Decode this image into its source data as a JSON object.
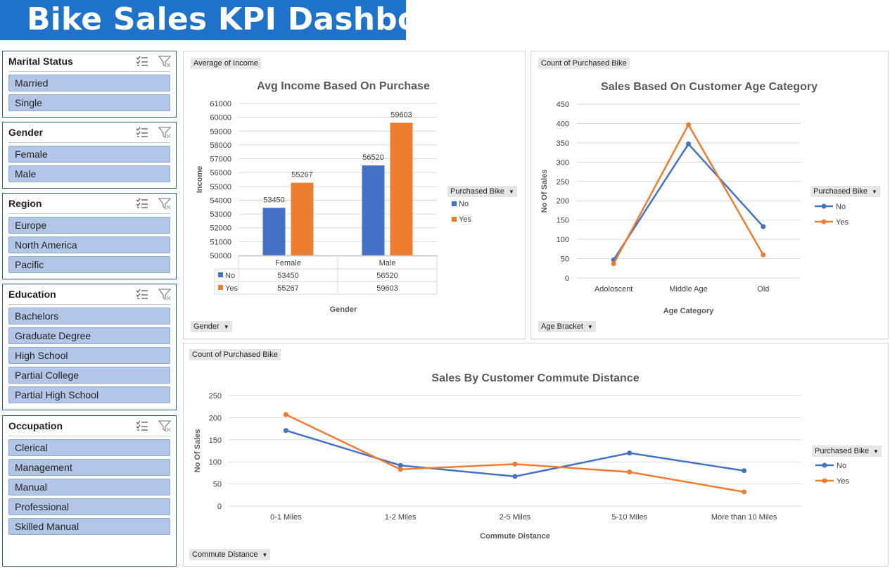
{
  "header": {
    "title": "Bike Sales KPI Dashboard"
  },
  "slicers": [
    {
      "title": "Marital Status",
      "items": [
        "Married",
        "Single"
      ]
    },
    {
      "title": "Gender",
      "items": [
        "Female",
        "Male"
      ]
    },
    {
      "title": "Region",
      "items": [
        "Europe",
        "North America",
        "Pacific"
      ]
    },
    {
      "title": "Education",
      "items": [
        "Bachelors",
        "Graduate Degree",
        "High School",
        "Partial College",
        "Partial High School"
      ]
    },
    {
      "title": "Occupation",
      "items": [
        "Clerical",
        "Management",
        "Manual",
        "Professional",
        "Skilled Manual"
      ]
    }
  ],
  "panels": {
    "income": {
      "value_field": "Average of Income",
      "axis_field": "Gender",
      "legend_field": "Purchased Bike"
    },
    "age": {
      "value_field": "Count of Purchased Bike",
      "axis_field": "Age Bracket",
      "legend_field": "Purchased Bike"
    },
    "commute": {
      "value_field": "Count of Purchased Bike",
      "axis_field": "Commute Distance",
      "legend_field": "Purchased Bike"
    }
  },
  "colors": {
    "no": "#4472c4",
    "yes": "#ed7d31",
    "accent": "#1f72c9"
  },
  "chart_data": [
    {
      "type": "bar",
      "title": "Avg Income Based On Purchase",
      "xlabel": "Gender",
      "ylabel": "Income",
      "categories": [
        "Female",
        "Male"
      ],
      "series": [
        {
          "name": "No",
          "values": [
            53450,
            56520
          ]
        },
        {
          "name": "Yes",
          "values": [
            55267,
            59603
          ]
        }
      ],
      "ylim": [
        50000,
        61000
      ],
      "yticks": [
        50000,
        51000,
        52000,
        53000,
        54000,
        55000,
        56000,
        57000,
        58000,
        59000,
        60000,
        61000
      ],
      "data_table": true,
      "legend": "right",
      "grid": true
    },
    {
      "type": "line",
      "title": "Sales Based On Customer Age Category",
      "xlabel": "Age Category",
      "ylabel": "No Of Sales",
      "categories": [
        "Adoloscent",
        "Middle Age",
        "Old"
      ],
      "series": [
        {
          "name": "No",
          "values": [
            47,
            347,
            133
          ]
        },
        {
          "name": "Yes",
          "values": [
            37,
            397,
            60
          ]
        }
      ],
      "ylim": [
        0,
        450
      ],
      "yticks": [
        0,
        50,
        100,
        150,
        200,
        250,
        300,
        350,
        400,
        450
      ],
      "legend": "right",
      "grid": true
    },
    {
      "type": "line",
      "title": "Sales By Customer Commute Distance",
      "xlabel": "Commute Distance",
      "ylabel": "No Of Sales",
      "categories": [
        "0-1 Miles",
        "1-2 Miles",
        "2-5 Miles",
        "5-10 Miles",
        "More than 10 Miles"
      ],
      "series": [
        {
          "name": "No",
          "values": [
            171,
            92,
            67,
            120,
            80
          ]
        },
        {
          "name": "Yes",
          "values": [
            207,
            83,
            95,
            77,
            32
          ]
        }
      ],
      "ylim": [
        0,
        250
      ],
      "yticks": [
        0,
        50,
        100,
        150,
        200,
        250
      ],
      "legend": "right",
      "grid": true
    }
  ]
}
